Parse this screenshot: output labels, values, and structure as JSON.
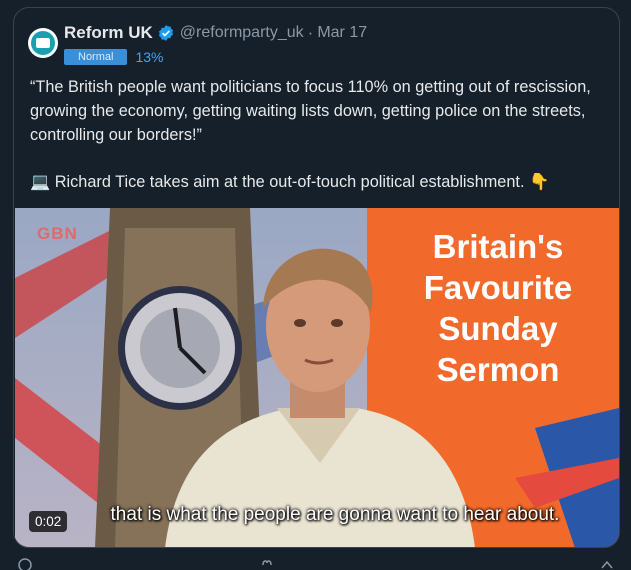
{
  "account": {
    "name": "Reform UK",
    "handle": "@reformparty_uk",
    "separator": "·",
    "date": "Mar 17",
    "badge": "Normal",
    "percent": "13%"
  },
  "tweet": {
    "quote": "“The British people want politicians to focus 110% on getting out of rescission, growing the economy, getting waiting lists down, getting police on the streets, controlling our borders!”",
    "line2": "💻 Richard Tice takes aim at the out-of-touch political establishment. 👇"
  },
  "video": {
    "channel_logo": "GBN",
    "banner": [
      "Britain's",
      "Favourite",
      "Sunday",
      "Sermon"
    ],
    "subtitle": "that is what the people are gonna want to hear about.",
    "duration": "0:02"
  },
  "colors": {
    "accent": "#1d9bf0",
    "banner_orange": "#f26a2b"
  }
}
